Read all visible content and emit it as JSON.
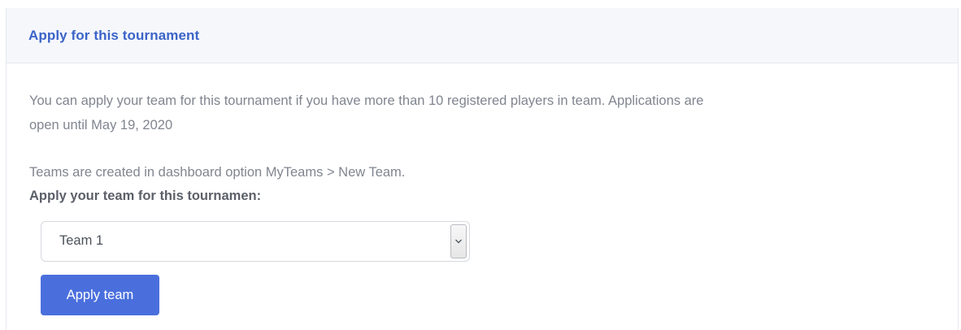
{
  "header": {
    "title": "Apply for this tournament"
  },
  "body": {
    "description_line1": "You can apply your team for this tournament if you have more than 10 registered players in team. Applications are",
    "description_line2": "open until May 19, 2020",
    "note": "Teams are created in dashboard option MyTeams > New Team.",
    "select_label": "Apply your team for this tournamen:"
  },
  "team_select": {
    "selected_value": "Team 1",
    "icon": "chevron-down-icon"
  },
  "actions": {
    "apply_label": "Apply team"
  },
  "colors": {
    "title": "#3b64c8",
    "header_bg": "#f5f7fb",
    "button_bg": "#4a6fdd",
    "text_muted": "#80858f"
  }
}
